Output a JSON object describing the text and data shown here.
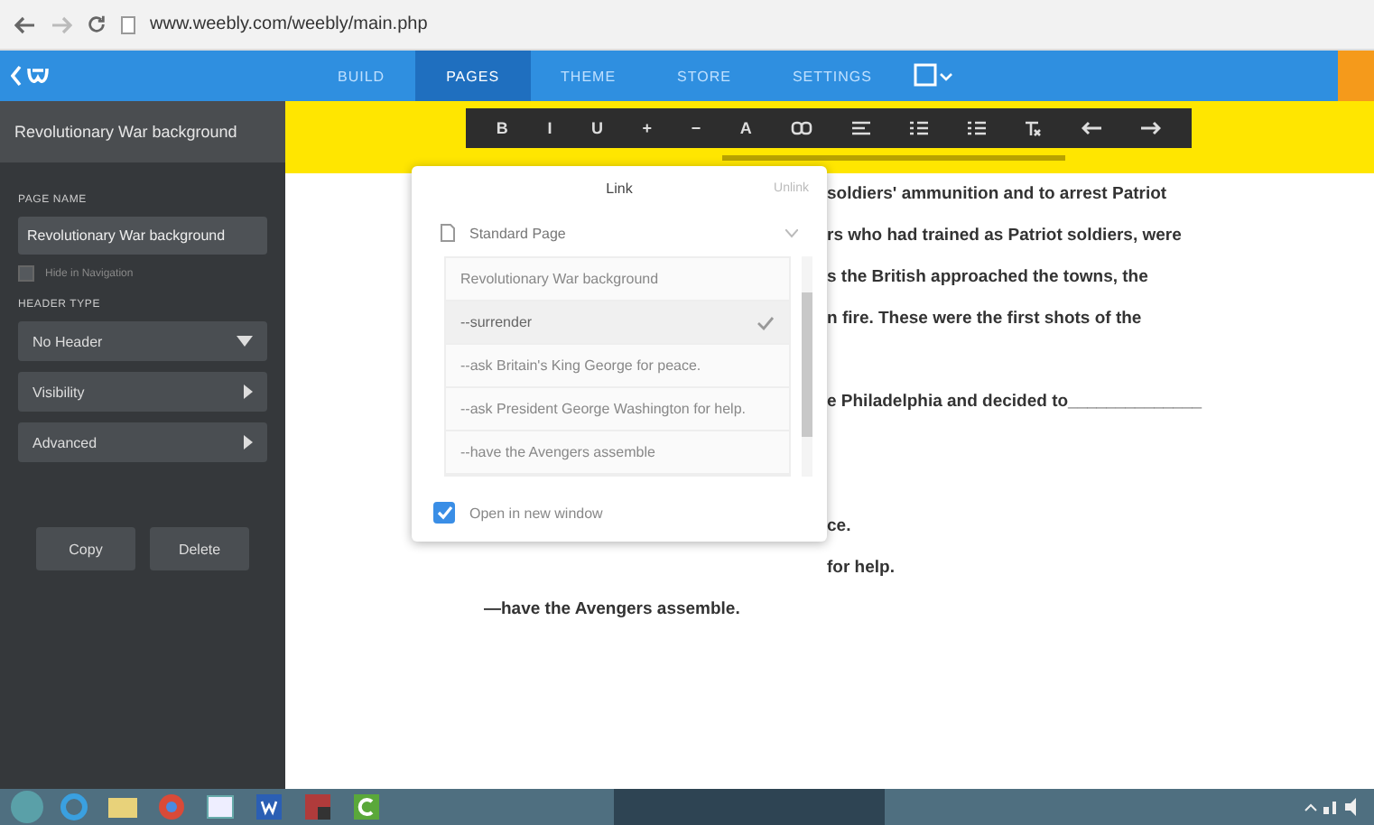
{
  "browser": {
    "url": "www.weebly.com/weebly/main.php"
  },
  "nav": {
    "tabs": [
      {
        "label": "BUILD",
        "selected": false
      },
      {
        "label": "PAGES",
        "selected": true
      },
      {
        "label": "THEME",
        "selected": false
      },
      {
        "label": "STORE",
        "selected": false
      },
      {
        "label": "SETTINGS",
        "selected": false
      }
    ]
  },
  "sidebar": {
    "title": "Revolutionary War background",
    "page_name_label": "PAGE NAME",
    "page_name": "Revolutionary War background",
    "hide_in_navigation": {
      "label": "Hide in Navigation",
      "checked": false
    },
    "header_type_label": "HEADER TYPE",
    "header_type": "No Header",
    "sections": [
      "Visibility",
      "Advanced"
    ],
    "buttons": [
      "Copy",
      "Delete"
    ]
  },
  "toolbar": {
    "buttons": [
      {
        "kind": "text",
        "label": "B"
      },
      {
        "kind": "text",
        "label": "I"
      },
      {
        "kind": "text",
        "label": "U"
      },
      {
        "kind": "text",
        "label": "+"
      },
      {
        "kind": "text",
        "label": "−"
      },
      {
        "kind": "text",
        "label": "A"
      },
      {
        "kind": "link"
      },
      {
        "kind": "align"
      },
      {
        "kind": "list"
      },
      {
        "kind": "list"
      },
      {
        "kind": "clear"
      },
      {
        "kind": "undo"
      },
      {
        "kind": "redo"
      }
    ]
  },
  "link_popup": {
    "title": "Link",
    "unlink": "Unlink",
    "link_type": "Standard Page",
    "options": [
      {
        "label": "Revolutionary War background",
        "selected": false
      },
      {
        "label": "--surrender",
        "selected": true
      },
      {
        "label": "--ask Britain's King George for peace.",
        "selected": false
      },
      {
        "label": "--ask President George Washington for help.",
        "selected": false
      },
      {
        "label": "--have the Avengers assemble",
        "selected": false
      }
    ],
    "open_in_new_window": {
      "label": "Open in new window",
      "checked": true
    }
  },
  "document": {
    "lines": [
      {
        "kind": "partial",
        "text": "soldiers' ammunition and to arrest Patriot"
      },
      {
        "kind": "partial",
        "text": "rs who had trained as Patriot soldiers, were"
      },
      {
        "kind": "partial",
        "text": "s the British approached the towns, the"
      },
      {
        "kind": "partial",
        "text": "n fire.  These were the first shots of the"
      },
      {
        "kind": "gap"
      },
      {
        "kind": "partial",
        "text": "e Philadelphia and decided to______________"
      },
      {
        "kind": "gap"
      },
      {
        "kind": "gap"
      },
      {
        "kind": "partial",
        "text": "ce."
      },
      {
        "kind": "partial",
        "text": "for help."
      },
      {
        "kind": "full",
        "text": "—have the Avengers assemble."
      }
    ]
  }
}
